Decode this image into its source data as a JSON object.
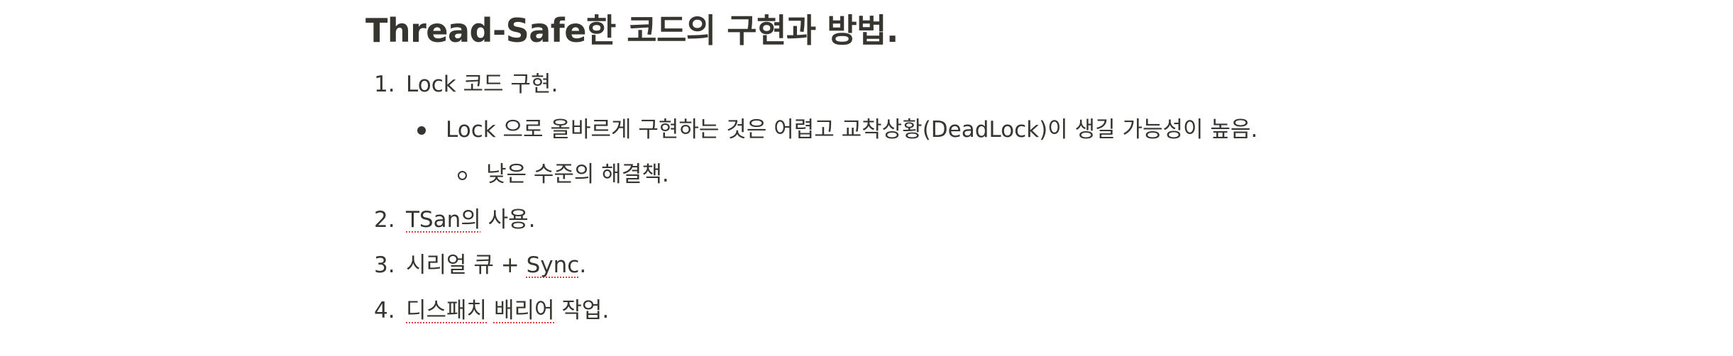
{
  "title": "Thread-Safe한 코드의 구현과 방법.",
  "list": {
    "item1": {
      "number": "1.",
      "text": "Lock 코드 구현."
    },
    "item1_bullet": {
      "text": "Lock 으로 올바르게 구현하는 것은 어렵고 교착상황(DeadLock)이 생길 가능성이 높음."
    },
    "item1_subbullet": {
      "text": "낮은 수준의 해결책."
    },
    "item2": {
      "number": "2.",
      "underlined": "TSan의",
      "rest": " 사용."
    },
    "item3": {
      "number": "3.",
      "lead": "시리얼 큐 + ",
      "underlined": "Sync",
      "rest": "."
    },
    "item4": {
      "number": "4.",
      "underlined_a": "디스패치",
      "space": " ",
      "underlined_b": "배리어",
      "rest": " 작업."
    }
  },
  "colors": {
    "text": "#37352f",
    "spellcheck_underline": "#e03e3e",
    "background": "#ffffff"
  }
}
